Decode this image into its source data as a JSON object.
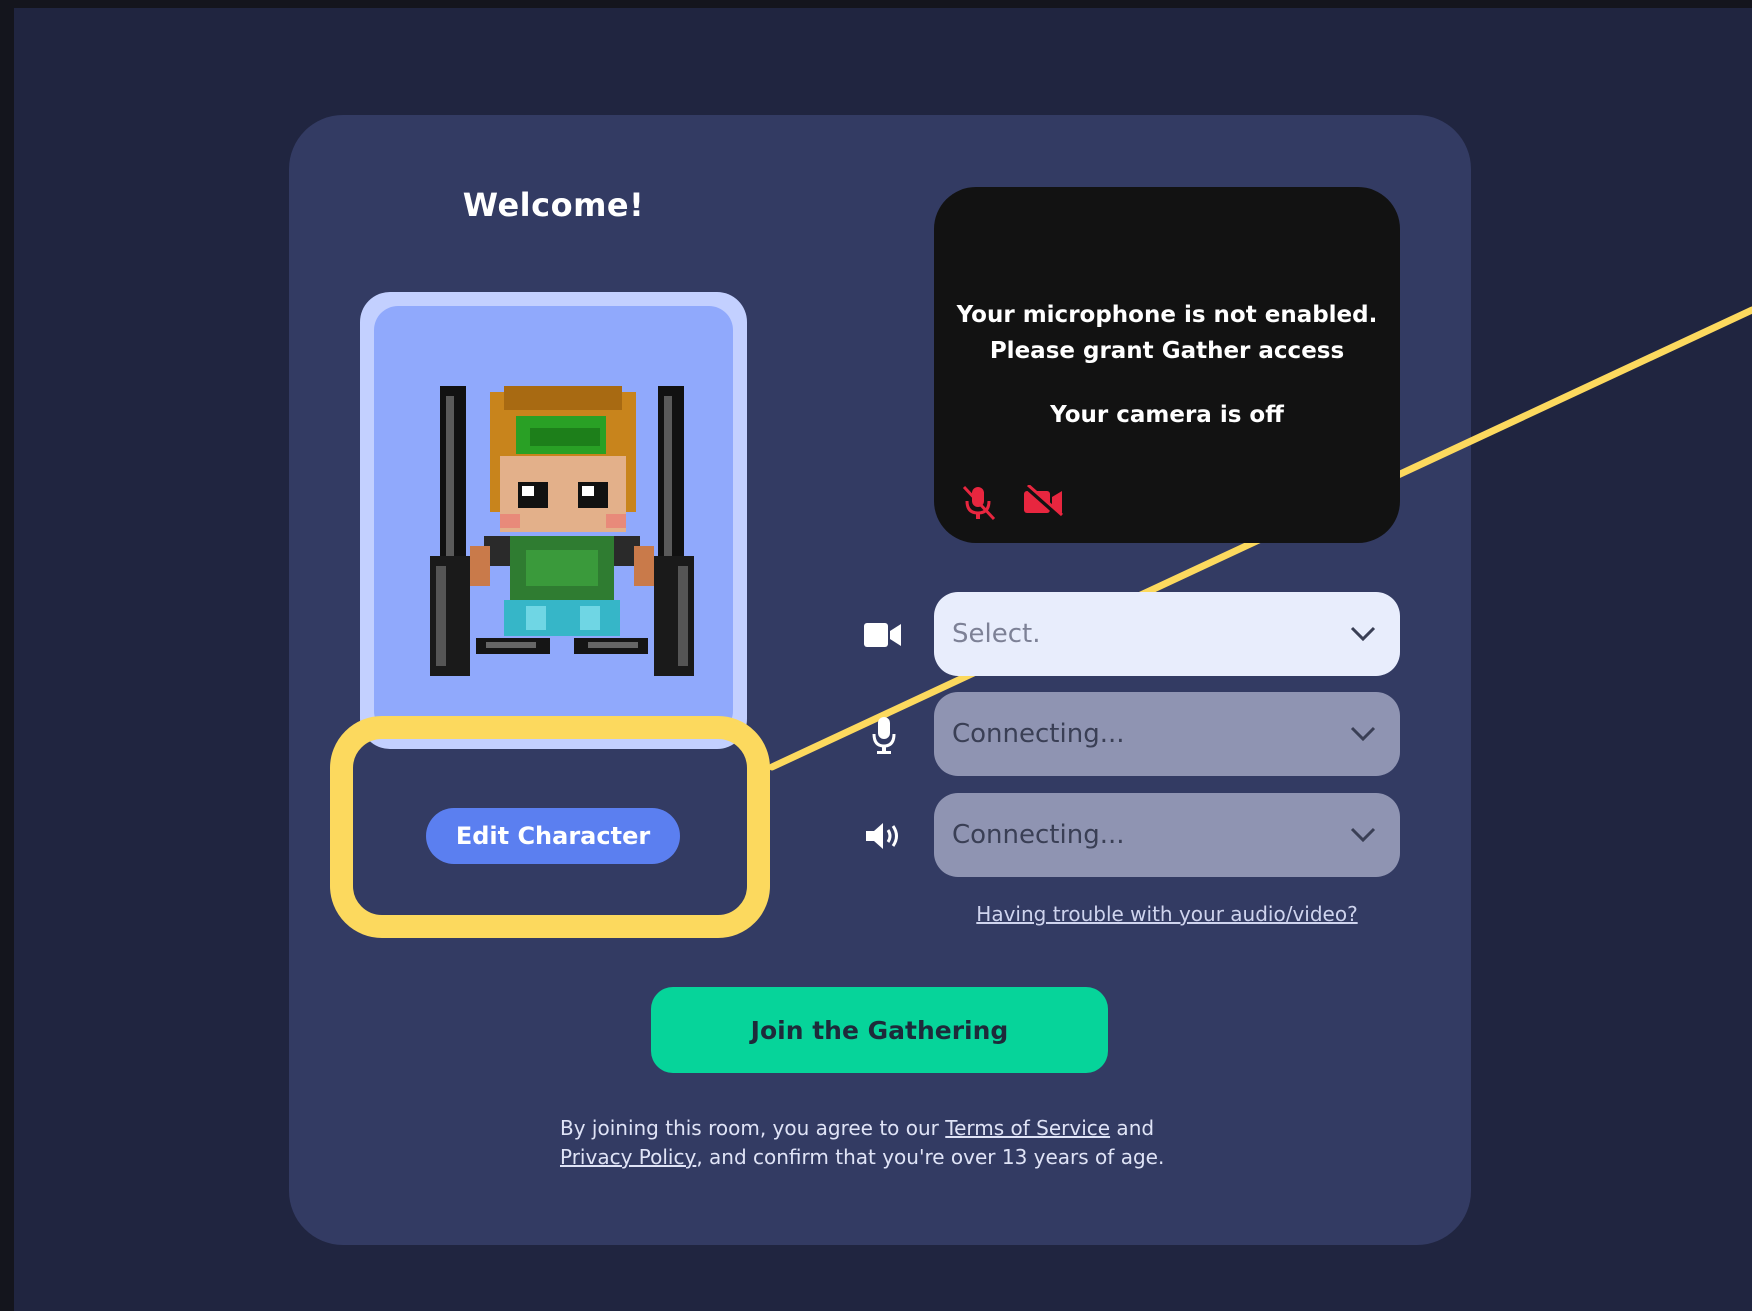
{
  "welcome": {
    "title": "Welcome!",
    "edit_character_label": "Edit Character"
  },
  "video_preview": {
    "mic_message_line1": "Your microphone is not enabled.",
    "mic_message_line2": "Please grant Gather access",
    "camera_message": "Your camera is off",
    "icons": [
      "mic-muted-icon",
      "camera-off-icon"
    ],
    "muted_color": "#e8263f"
  },
  "devices": {
    "camera": {
      "icon": "camera-icon",
      "value": "Select."
    },
    "microphone": {
      "icon": "microphone-icon",
      "value": "Connecting..."
    },
    "speaker": {
      "icon": "speaker-icon",
      "value": "Connecting..."
    }
  },
  "trouble_link": "Having trouble with your audio/video?",
  "join_button": "Join the Gathering",
  "legal": {
    "prefix": "By joining this room, you agree to our ",
    "terms": "Terms of Service",
    "and": " and",
    "privacy": "Privacy Policy",
    "suffix": ", and confirm that you're over 13 years of age."
  },
  "colors": {
    "card": "#333b63",
    "accent": "#5b7ff0",
    "join": "#06d49a",
    "highlight": "#fcd95e"
  }
}
